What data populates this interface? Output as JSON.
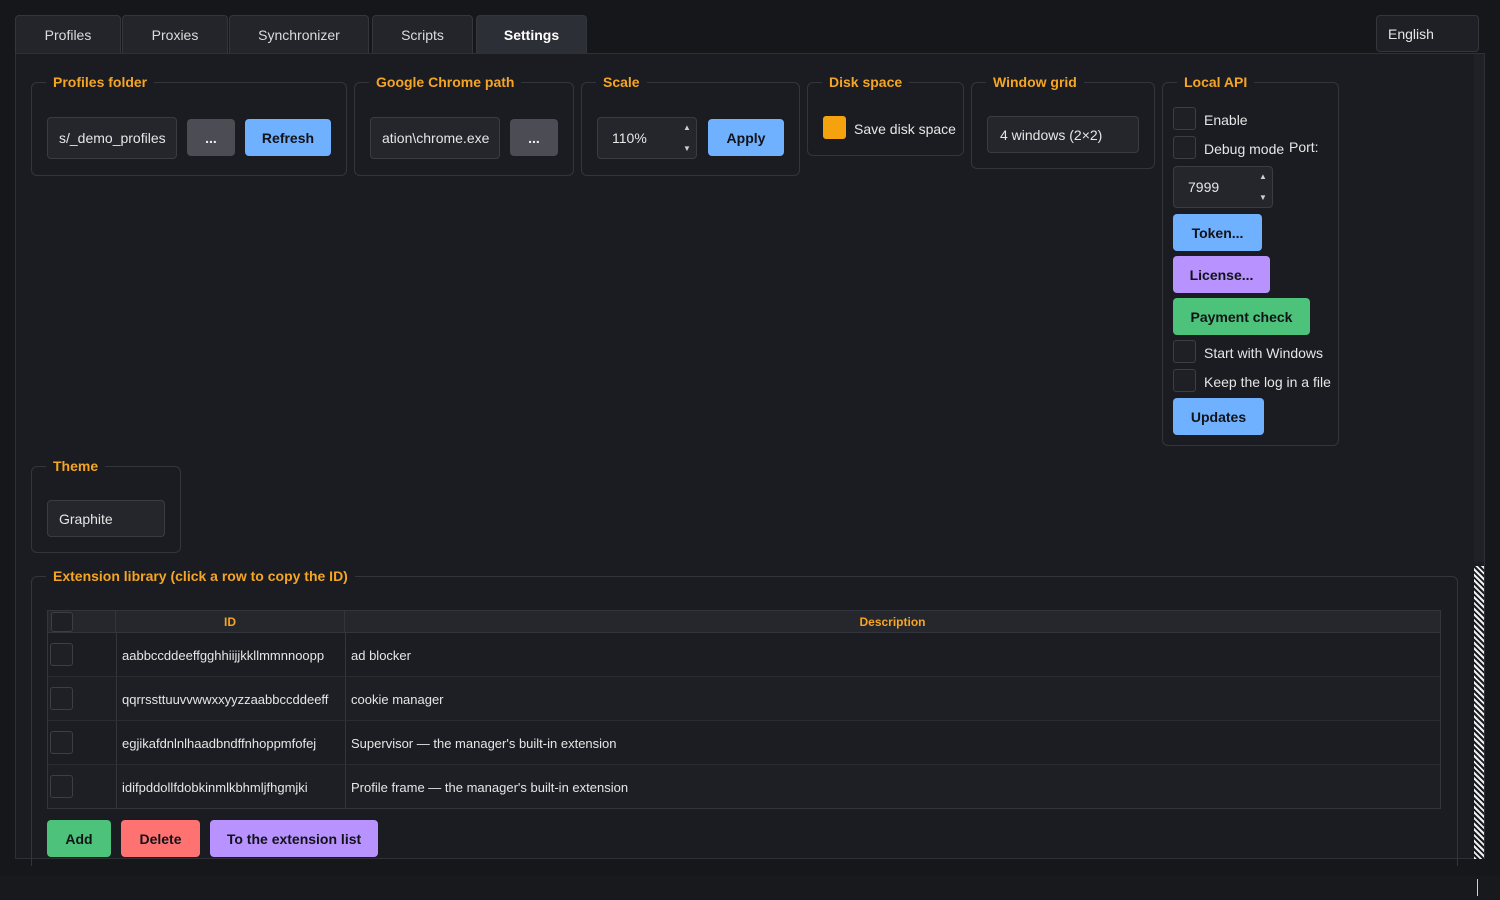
{
  "tabs": [
    {
      "label": "Profiles",
      "active": false
    },
    {
      "label": "Proxies",
      "active": false
    },
    {
      "label": "Synchronizer",
      "active": false
    },
    {
      "label": "Scripts",
      "active": false
    },
    {
      "label": "Settings",
      "active": true
    }
  ],
  "language": "English",
  "profiles_folder": {
    "legend": "Profiles folder",
    "path_value": "s/_demo_profiles",
    "browse_label": "...",
    "refresh_label": "Refresh"
  },
  "chrome_path": {
    "legend": "Google Chrome path",
    "path_value": "ation\\chrome.exe",
    "browse_label": "..."
  },
  "scale": {
    "legend": "Scale",
    "value": "110%",
    "apply_label": "Apply"
  },
  "disk_space": {
    "legend": "Disk space",
    "checkbox_label": "Save disk space",
    "checked": true
  },
  "window_grid": {
    "legend": "Window grid",
    "selected": "4 windows (2×2)"
  },
  "local_api": {
    "legend": "Local API",
    "enable_label": "Enable",
    "debug_label": "Debug mode",
    "port_label": "Port:",
    "port_value": "7999",
    "token_label": "Token...",
    "license_label": "License...",
    "payment_label": "Payment check",
    "start_windows_label": "Start with Windows",
    "keep_log_label": "Keep the log in a file",
    "updates_label": "Updates"
  },
  "theme": {
    "legend": "Theme",
    "selected": "Graphite"
  },
  "extension_library": {
    "legend": "Extension library (click a row to copy the ID)",
    "columns": [
      "ID",
      "Description"
    ],
    "rows": [
      {
        "id": "aabbccddeeffgghhiijjkkllmmnnoopp",
        "description": "ad blocker"
      },
      {
        "id": "qqrrssttuuvvwwxxyyzzaabbccddeeff",
        "description": "cookie manager"
      },
      {
        "id": "egjikafdnlnlhaadbndffnhoppmfofej",
        "description": "Supervisor — the manager's built-in extension"
      },
      {
        "id": "idifpddollfdobkinmlkbhmljfhgmjki",
        "description": "Profile frame — the manager's built-in extension"
      }
    ],
    "add_label": "Add",
    "delete_label": "Delete",
    "to_list_label": "To the extension list"
  },
  "colors": {
    "accent": "#f5a524",
    "blue": "#6fb0ff",
    "purple": "#b892ff",
    "green": "#4cc27a",
    "red": "#ff7272",
    "background": "#1b1c21"
  }
}
